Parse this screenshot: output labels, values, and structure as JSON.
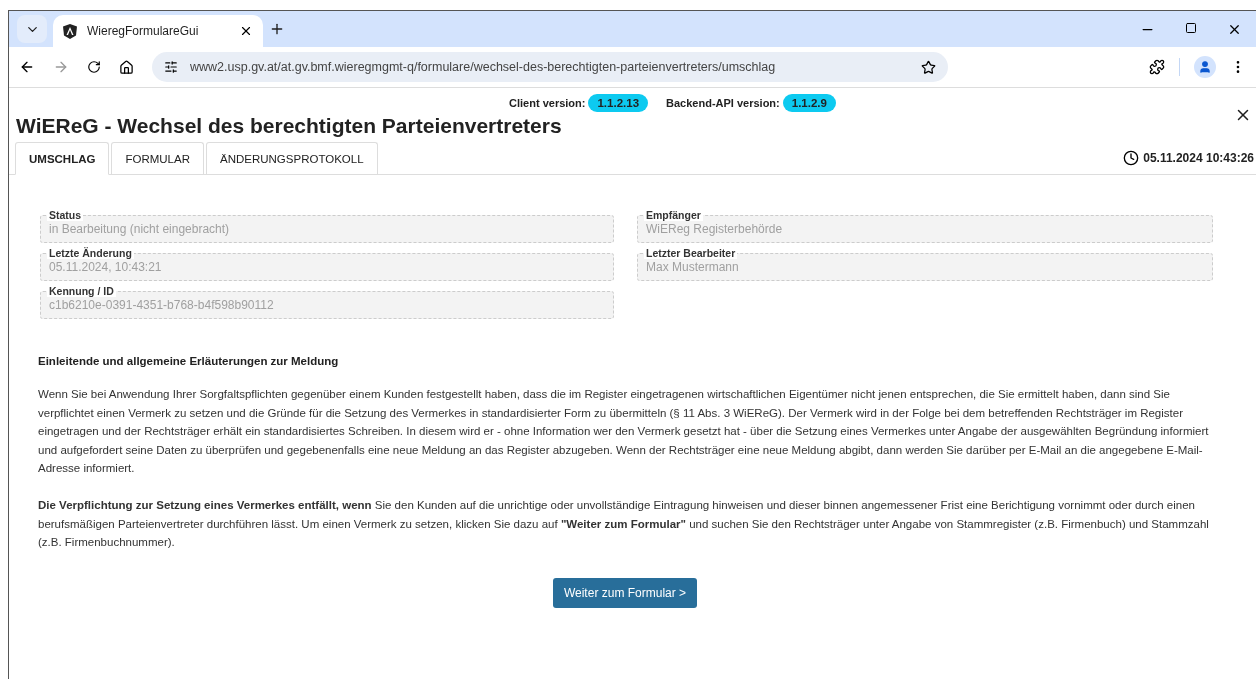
{
  "browser": {
    "tab_title": "WieregFormulareGui",
    "url": "www2.usp.gv.at/at.gv.bmf.wieregmgmt-q/formulare/wechsel-des-berechtigten-parteienvertreters/umschlag"
  },
  "versions": [
    {
      "label": "Client version:",
      "value": "1.1.2.13"
    },
    {
      "label": "Backend-API version:",
      "value": "1.1.2.9"
    }
  ],
  "title": "WiEReG - Wechsel des berechtigten Parteienvertreters",
  "tabs": [
    {
      "label": "UMSCHLAG",
      "selected": true
    },
    {
      "label": "FORMULAR",
      "selected": false
    },
    {
      "label": "ÄNDERUNGSPROTOKOLL",
      "selected": false
    }
  ],
  "timestamp": "05.11.2024 10:43:26",
  "field_columns": [
    [
      {
        "label": "Status",
        "value": "in Bearbeitung (nicht eingebracht)"
      },
      {
        "label": "Letzte Änderung",
        "value": "05.11.2024, 10:43:21"
      },
      {
        "label": "Kennung / ID",
        "value": "c1b6210e-0391-4351-b768-b4f598b90112"
      }
    ],
    [
      {
        "label": "Empfänger",
        "value": "WiEReg Registerbehörde"
      },
      {
        "label": "Letzter Bearbeiter",
        "value": "Max Mustermann"
      }
    ]
  ],
  "section_heading": "Einleitende und allgemeine Erläuterungen zur Meldung",
  "paragraphs": [
    "Wenn Sie bei Anwendung Ihrer Sorgfaltspflichten gegenüber einem Kunden festgestellt haben, dass die im Register eingetragenen wirtschaftlichen Eigentümer nicht jenen entsprechen, die Sie ermittelt haben, dann sind Sie verpflichtet einen Vermerk zu setzen und die Gründe für die Setzung des Vermerkes in standardisierter Form zu übermitteln (§ 11 Abs. 3 WiEReG). Der Vermerk wird in der Folge bei dem betreffenden Rechtsträger im Register eingetragen und der Rechtsträger erhält ein standardisiertes Schreiben. In diesem wird er - ohne Information wer den Vermerk gesetzt hat - über die Setzung eines Vermerkes unter Angabe der ausgewählten Begründung informiert und aufgefordert seine Daten zu überprüfen und gegebenenfalls eine neue Meldung an das Register abzugeben. Wenn der Rechtsträger eine neue Meldung abgibt, dann werden Sie darüber per E-Mail an die angegebene E-Mail-Adresse informiert.",
    "**Die Verpflichtung zur Setzung eines Vermerkes entfällt, wenn** Sie den Kunden auf die unrichtige oder unvollständige Eintragung hinweisen und dieser binnen angemessener Frist eine Berichtigung vornimmt oder durch einen berufsmäßigen Parteienvertreter durchführen lässt. Um einen Vermerk zu setzen, klicken Sie dazu auf **\"Weiter zum Formular\"** und suchen Sie den Rechtsträger unter Angabe von Stammregister (z.B. Firmenbuch) und Stammzahl (z.B. Firmenbuchnummer)."
  ],
  "button": "Weiter zum Formular >"
}
